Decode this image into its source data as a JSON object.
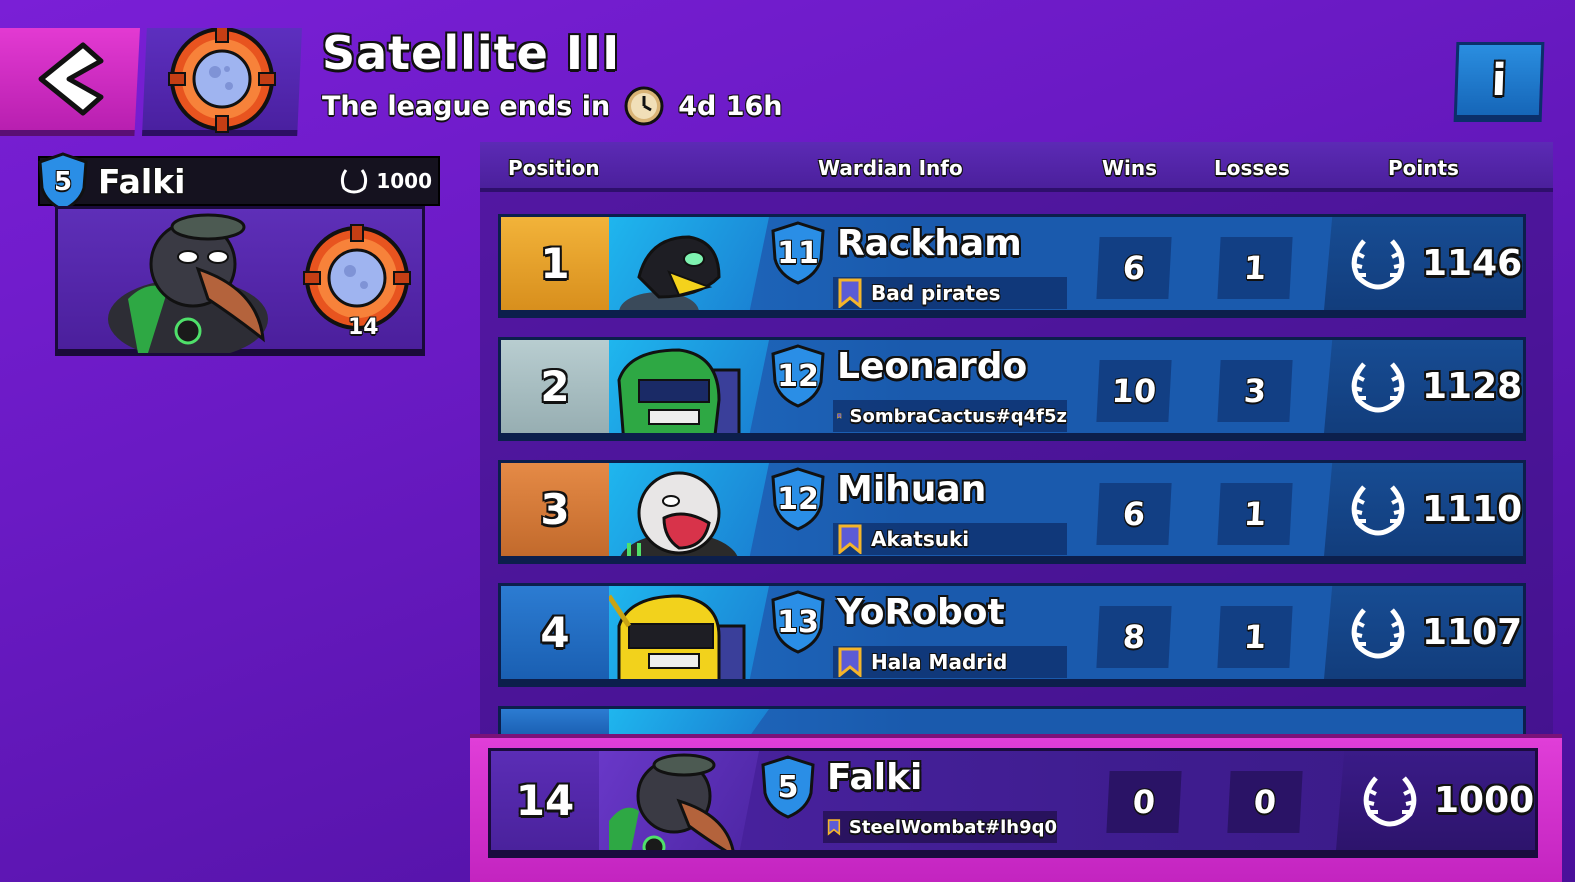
{
  "header": {
    "title": "Satellite III",
    "subtitle_prefix": "The league ends in",
    "time_left": "4d 16h",
    "info_label": "i"
  },
  "player": {
    "level": "5",
    "name": "Falki",
    "points": "1000",
    "emblem_level": "14"
  },
  "table": {
    "headers": [
      "Position",
      "Wardian Info",
      "Wins",
      "Losses",
      "Points"
    ],
    "rows": [
      {
        "pos": "1",
        "level": "11",
        "name": "Rackham",
        "guild": "Bad pirates",
        "wins": "6",
        "losses": "1",
        "points": "1146"
      },
      {
        "pos": "2",
        "level": "12",
        "name": "Leonardo",
        "guild": "SombraCactus#q4f5z",
        "wins": "10",
        "losses": "3",
        "points": "1128"
      },
      {
        "pos": "3",
        "level": "12",
        "name": "Mihuan",
        "guild": "Akatsuki",
        "wins": "6",
        "losses": "1",
        "points": "1110"
      },
      {
        "pos": "4",
        "level": "13",
        "name": "YoRobot",
        "guild": "Hala Madrid",
        "wins": "8",
        "losses": "1",
        "points": "1107"
      }
    ],
    "self_row": {
      "pos": "14",
      "level": "5",
      "name": "Falki",
      "guild": "SteelWombat#lh9q0",
      "wins": "0",
      "losses": "0",
      "points": "1000"
    }
  },
  "colors": {
    "background": "#6a1ac4",
    "row_blue": "#1a5aad",
    "gold": "#f2b33a",
    "silver": "#b8cdd0",
    "bronze": "#e58a46",
    "self_highlight": "#e03ed8"
  }
}
